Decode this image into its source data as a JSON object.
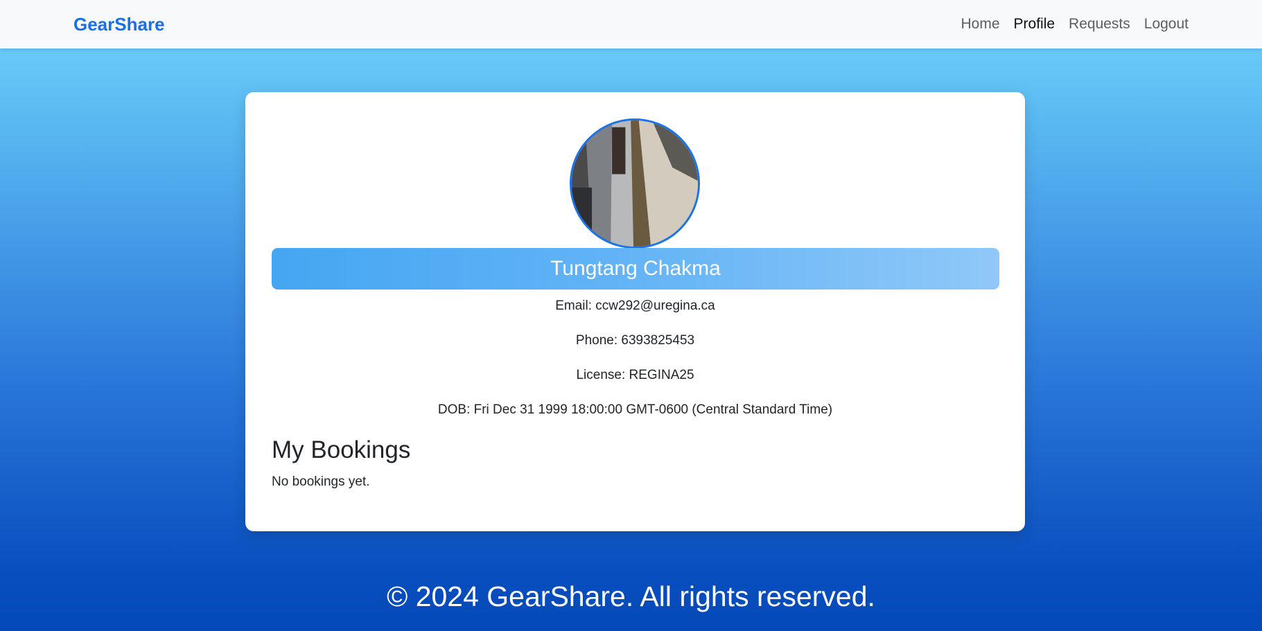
{
  "nav": {
    "brand": "GearShare",
    "links": [
      {
        "label": "Home"
      },
      {
        "label": "Profile",
        "active": true
      },
      {
        "label": "Requests"
      },
      {
        "label": "Logout"
      }
    ]
  },
  "profile": {
    "name": "Tungtang Chakma",
    "email": "Email: ccw292@uregina.ca",
    "phone": "Phone: 6393825453",
    "license": "License: REGINA25",
    "dob": "DOB: Fri Dec 31 1999 18:00:00 GMT-0600 (Central Standard Time)"
  },
  "bookings": {
    "title": "My Bookings",
    "empty_message": "No bookings yet."
  },
  "footer": {
    "text": "© 2024 GearShare. All rights reserved."
  },
  "colors": {
    "brand": "#1a6fe8",
    "avatar_border": "#1a73e8",
    "banner_start": "#45a6f2",
    "banner_end": "#90c8f8"
  }
}
